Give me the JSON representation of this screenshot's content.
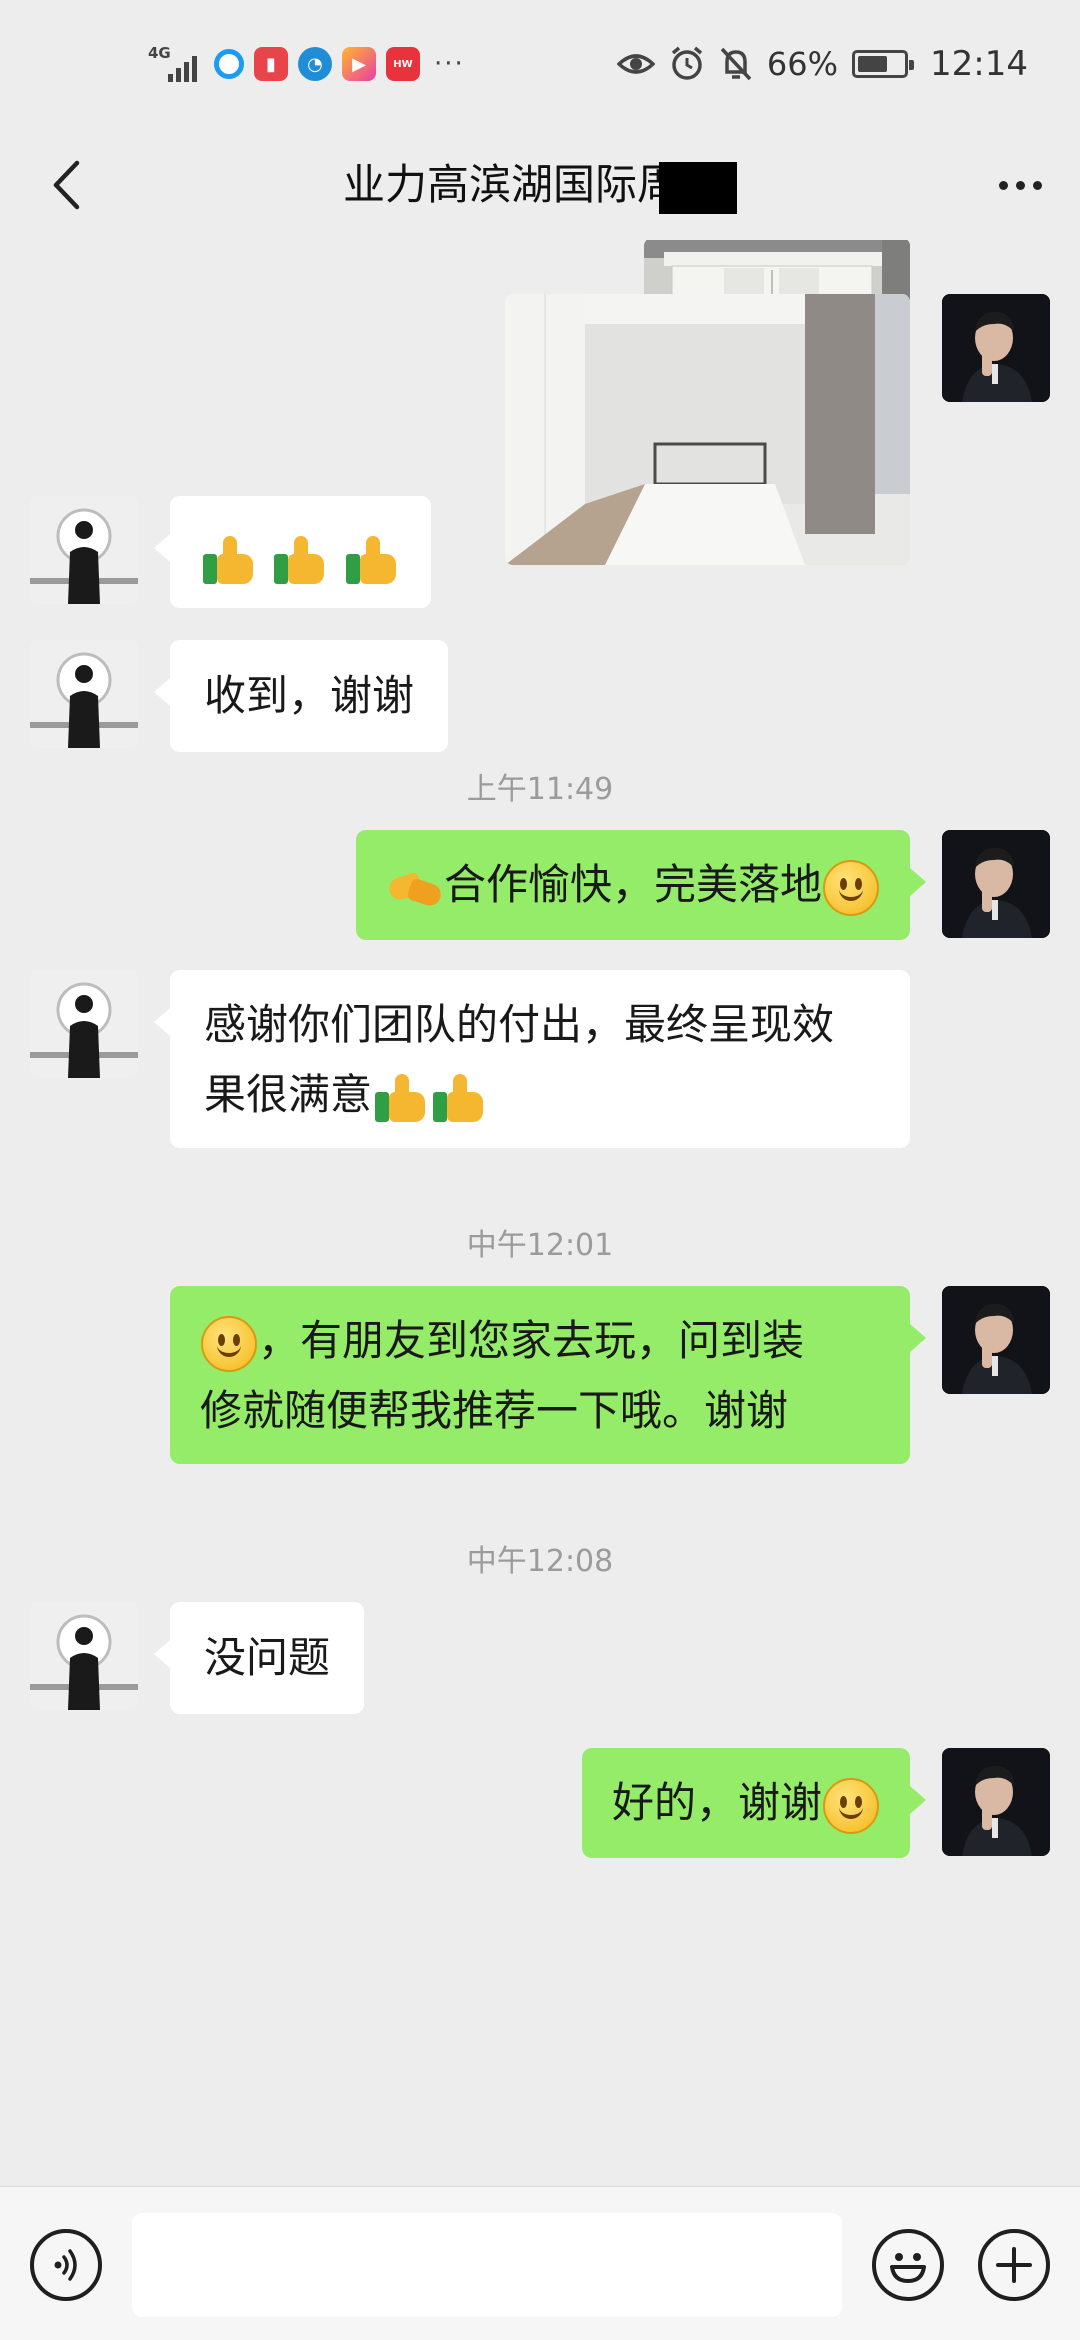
{
  "status_bar": {
    "network": "4G",
    "app_icons": [
      "qq-browser-icon",
      "reader-icon",
      "compass-icon",
      "video-icon",
      "huawei-store-icon"
    ],
    "overflow": "···",
    "battery_percent": "66%",
    "battery_level": 0.66,
    "time": "12:14",
    "indicator_icons": [
      "eye-icon",
      "alarm-icon",
      "mute-icon"
    ]
  },
  "header": {
    "title": "业力高滨湖国际周"
  },
  "messages": {
    "m1": {
      "text": "收到，谢谢"
    },
    "ts1": "上午11:49",
    "m2": {
      "text": "合作愉快，完美落地"
    },
    "m3": {
      "line1": "感谢你们团队的付出，最终呈现效",
      "line2": "果很满意"
    },
    "ts2": "中午12:01",
    "m4": {
      "line1": "，有朋友到您家去玩，问到装",
      "line2": "修就随便帮我推荐一下哦。谢谢"
    },
    "ts3": "中午12:08",
    "m5": {
      "text": "没问题"
    },
    "m6": {
      "text": "好的，谢谢"
    }
  },
  "colors": {
    "background": "#ededed",
    "bubble_sent": "#95ec69",
    "bubble_received": "#ffffff",
    "timestamp": "#9b9b9b"
  }
}
